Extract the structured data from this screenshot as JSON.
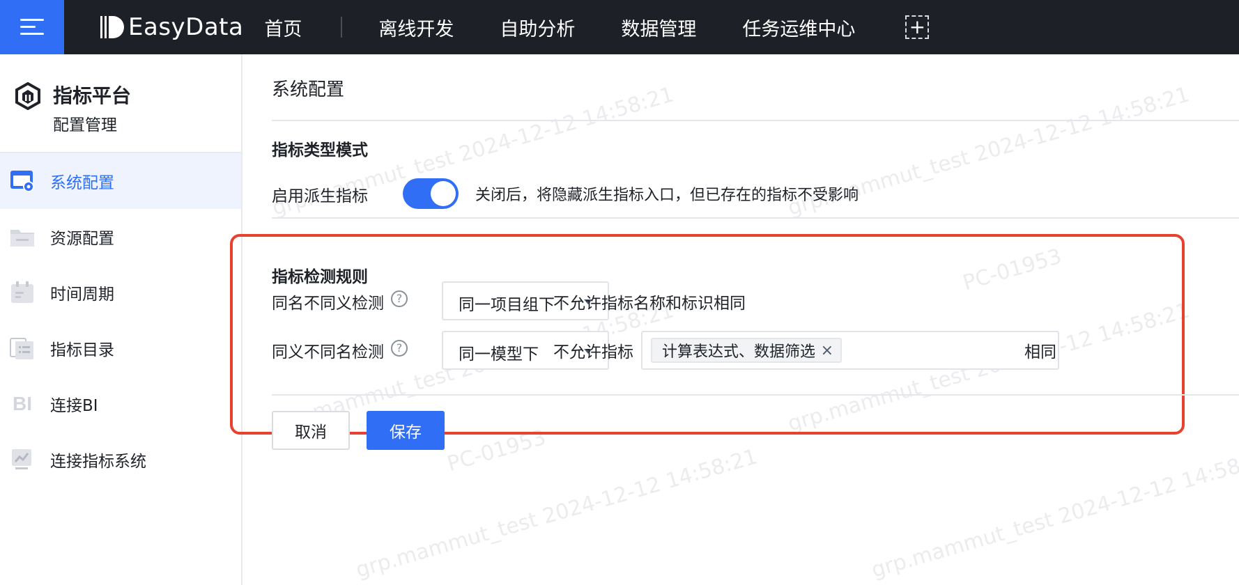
{
  "topbar": {
    "brand": "EasyData",
    "nav": [
      "首页",
      "离线开发",
      "自助分析",
      "数据管理",
      "任务运维中心"
    ]
  },
  "sidebar": {
    "title": "指标平台",
    "subtitle": "配置管理",
    "items": [
      {
        "label": "系统配置",
        "icon": "settings-window-icon",
        "active": true
      },
      {
        "label": "资源配置",
        "icon": "folder-icon"
      },
      {
        "label": "时间周期",
        "icon": "calendar-icon"
      },
      {
        "label": "指标目录",
        "icon": "catalog-list-icon"
      },
      {
        "label": "连接BI",
        "icon": "bi-icon"
      },
      {
        "label": "连接指标系统",
        "icon": "chart-board-icon"
      }
    ]
  },
  "main": {
    "page_title": "系统配置",
    "type_mode": {
      "title": "指标类型模式",
      "derived_label": "启用派生指标",
      "derived_enabled": true,
      "derived_hint": "关闭后，将隐藏派生指标入口，但已存在的指标不受影响"
    },
    "detection": {
      "title": "指标检测规则",
      "same_name": {
        "label": "同名不同义检测",
        "scope": "同一项目组下",
        "hint": "不允许指标名称和标识相同"
      },
      "same_meaning": {
        "label": "同义不同名检测",
        "scope": "同一模型下",
        "prefix": "不允许指标",
        "tag": "计算表达式、数据筛选",
        "suffix": "相同"
      }
    },
    "buttons": {
      "cancel": "取消",
      "save": "保存"
    }
  },
  "watermark": {
    "texts": [
      "grp.mammut_test 2024-12-12 14:58:21",
      "PC-01953"
    ]
  },
  "colors": {
    "accent": "#2f6ef5",
    "topbar": "#1d2127",
    "highlight": "#e8412f"
  }
}
